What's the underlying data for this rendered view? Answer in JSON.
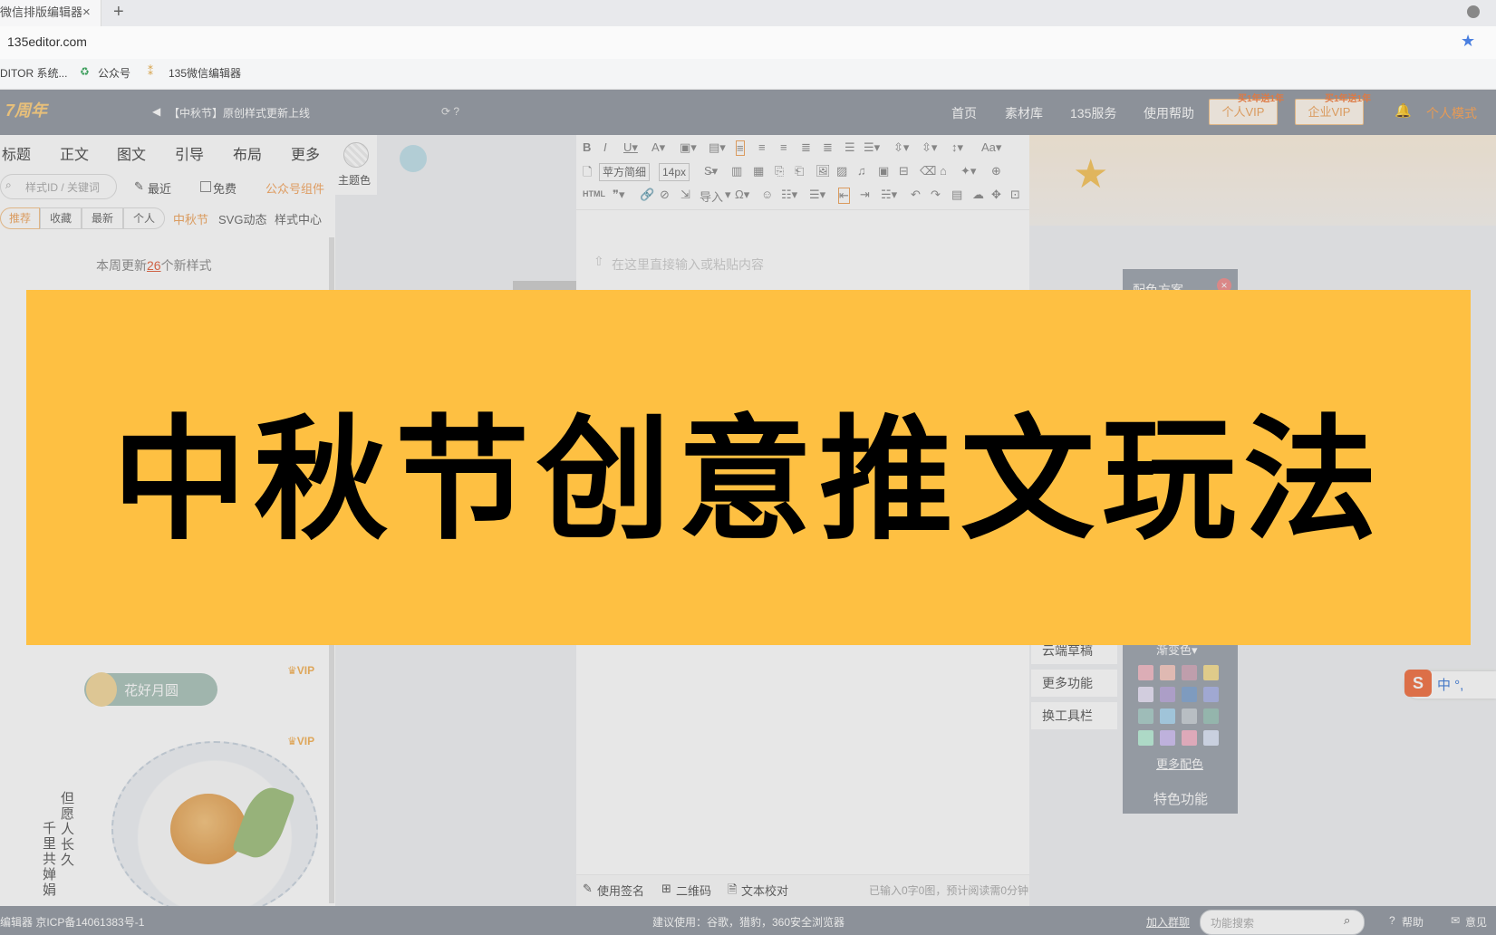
{
  "browser": {
    "tab_title": "微信排版编辑器",
    "tab_close": "×",
    "new_tab": "+",
    "url": "135editor.com",
    "bookmarks": [
      {
        "label": "DITOR 系统..."
      },
      {
        "label": "公众号"
      },
      {
        "label": "135微信编辑器"
      }
    ]
  },
  "header": {
    "logo": "7周年",
    "notice": "【中秋节】原创样式更新上线",
    "nav": [
      "首页",
      "素材库",
      "135服务",
      "使用帮助"
    ],
    "vip_personal": "个人VIP",
    "vip_enterprise": "企业VIP",
    "vip_tag": "买1年送1年",
    "mode": "个人模式"
  },
  "left_panel": {
    "categories": [
      "标题",
      "正文",
      "图文",
      "引导",
      "布局",
      "更多"
    ],
    "theme_label": "主题色",
    "search_placeholder": "样式ID / 关键词",
    "recent": "最近",
    "free": "免费",
    "gzh_component": "公众号组件",
    "segments": [
      "推荐",
      "收藏",
      "最新",
      "个人"
    ],
    "subtabs": [
      "中秋节",
      "SVG动态",
      "样式中心"
    ],
    "weekly_prefix": "本周更新",
    "weekly_count": "26",
    "weekly_suffix": "个新样式",
    "vip_mark": "VIP",
    "flower_title": "花好月圆",
    "poem_col1": "但愿人长久",
    "poem_col2": "千里共婵娟"
  },
  "editor": {
    "font_name": "苹方简细",
    "font_size": "14px",
    "html_label": "HTML",
    "import_label": "导入",
    "placeholder": "在这里直接输入或粘贴内容",
    "footer": {
      "signature": "使用签名",
      "qrcode": "二维码",
      "proofread": "文本校对",
      "word_count": "已输入0字0图，预计阅读需0分钟"
    }
  },
  "right_menu": [
    "云端草稿",
    "更多功能",
    "换工具栏"
  ],
  "color_panel": {
    "title": "配色方案",
    "gradient": "渐变色",
    "more": "更多配色",
    "special": "特色功能",
    "swatches": [
      "#f2b9c4",
      "#f6c7bf",
      "#cfa6b8",
      "#f6dd8e",
      "#e6e0f4",
      "#b7a6d8",
      "#7fa3cf",
      "#a9b2e6",
      "#a7cbc6",
      "#a9d5ee",
      "#c6cdd3",
      "#9ac3b8",
      "#b9eed7",
      "#cdbef2",
      "#f3b4c7",
      "#dbe3f6"
    ]
  },
  "ime": {
    "label": "中 °,"
  },
  "status_bar": {
    "left": "编辑器  京ICP备14061383号-1",
    "browser_tip": "建议使用：谷歌，猎豹，360安全浏览器",
    "join_group": "加入群聊",
    "function_search": "功能搜索",
    "help": "帮助",
    "feedback": "意见"
  },
  "banner": {
    "title": "中秋节创意推文玩法",
    "color": "#fec042"
  }
}
